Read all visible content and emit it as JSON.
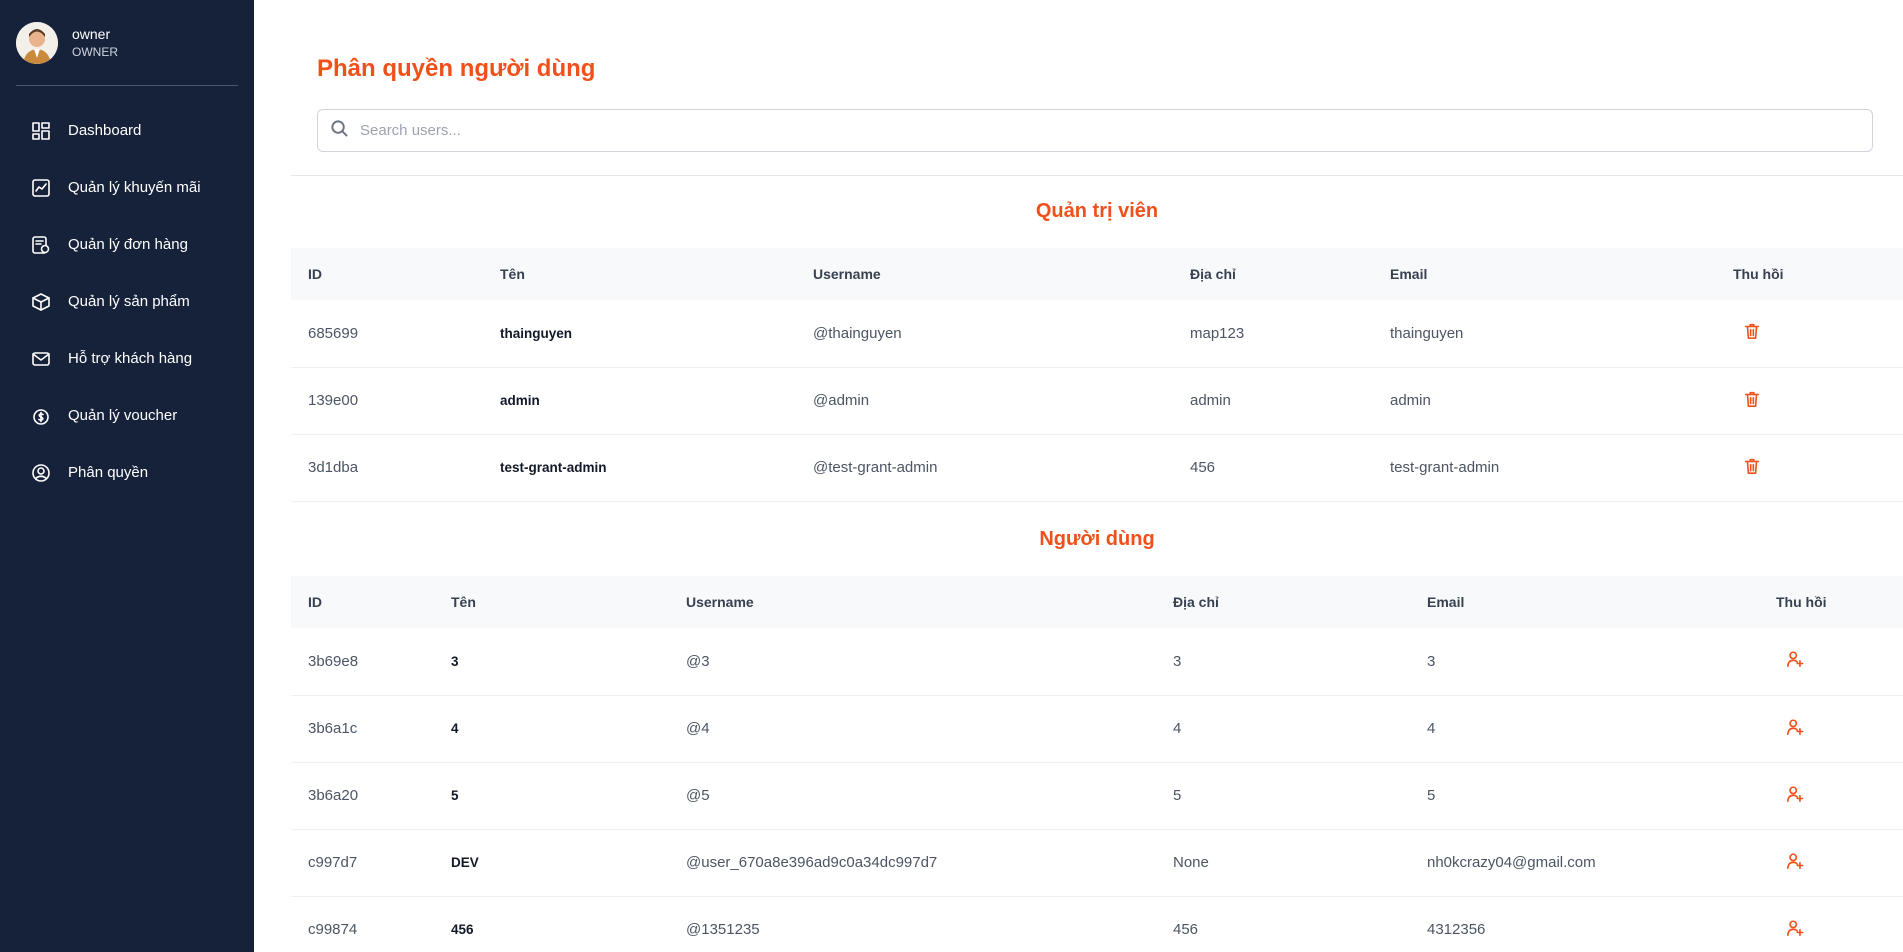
{
  "profile": {
    "name": "owner",
    "role": "OWNER"
  },
  "sidebar": {
    "items": [
      {
        "label": "Dashboard",
        "icon": "dashboard-icon"
      },
      {
        "label": "Quản lý khuyến mãi",
        "icon": "chart-line-icon"
      },
      {
        "label": "Quản lý đơn hàng",
        "icon": "order-icon"
      },
      {
        "label": "Quản lý sản phẩm",
        "icon": "box-icon"
      },
      {
        "label": "Hỗ trợ khách hàng",
        "icon": "mail-icon"
      },
      {
        "label": "Quản lý voucher",
        "icon": "dollar-circle-icon"
      },
      {
        "label": "Phân quyền",
        "icon": "user-circle-icon"
      }
    ]
  },
  "page": {
    "title": "Phân quyền người dùng",
    "search_placeholder": "Search users..."
  },
  "admins": {
    "title": "Quản trị viên",
    "headers": [
      "ID",
      "Tên",
      "Username",
      "Địa chỉ",
      "Email",
      "Thu hồi"
    ],
    "rows": [
      {
        "id": "685699",
        "name": "thainguyen",
        "username": "@thainguyen",
        "address": "map123",
        "email": "thainguyen"
      },
      {
        "id": "139e00",
        "name": "admin",
        "username": "@admin",
        "address": "admin",
        "email": "admin"
      },
      {
        "id": "3d1dba",
        "name": "test-grant-admin",
        "username": "@test-grant-admin",
        "address": "456",
        "email": "test-grant-admin"
      }
    ],
    "action_icon": "trash-icon"
  },
  "users": {
    "title": "Người dùng",
    "headers": [
      "ID",
      "Tên",
      "Username",
      "Địa chỉ",
      "Email",
      "Thu hồi"
    ],
    "rows": [
      {
        "id": "3b69e8",
        "name": "3",
        "username": "@3",
        "address": "3",
        "email": "3"
      },
      {
        "id": "3b6a1c",
        "name": "4",
        "username": "@4",
        "address": "4",
        "email": "4"
      },
      {
        "id": "3b6a20",
        "name": "5",
        "username": "@5",
        "address": "5",
        "email": "5"
      },
      {
        "id": "c997d7",
        "name": "DEV",
        "username": "@user_670a8e396ad9c0a34dc997d7",
        "address": "None",
        "email": "nh0kcrazy04@gmail.com"
      },
      {
        "id": "c99874",
        "name": "456",
        "username": "@1351235",
        "address": "456",
        "email": "4312356"
      }
    ],
    "action_icon": "user-plus-icon"
  },
  "colors": {
    "accent": "#f0501a",
    "sidebar": "#16213a"
  }
}
